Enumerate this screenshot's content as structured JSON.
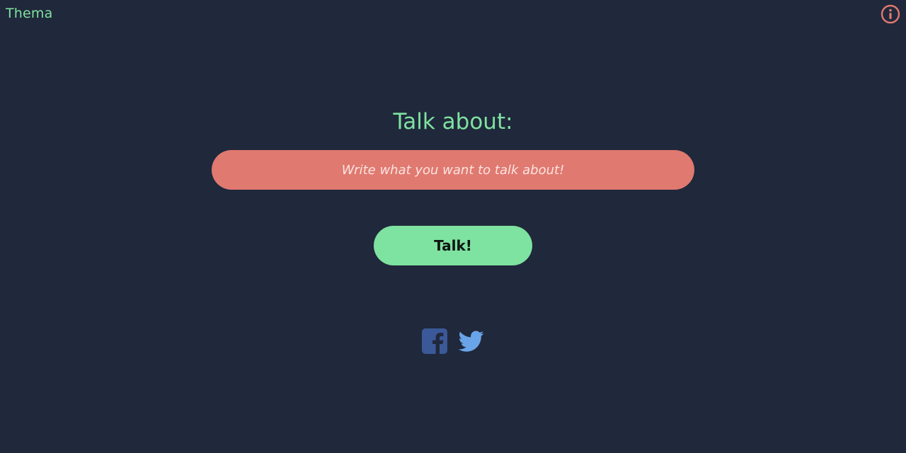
{
  "header": {
    "brand": "Thema",
    "info_icon": "info-circle-icon"
  },
  "main": {
    "heading": "Talk about:",
    "input": {
      "placeholder": "Write what you want to talk about!",
      "value": ""
    },
    "button_label": "Talk!"
  },
  "social": [
    {
      "icon": "facebook-icon",
      "color": "#3b5998"
    },
    {
      "icon": "twitter-icon",
      "color": "#55acee"
    }
  ],
  "colors": {
    "background": "#20283b",
    "accent_green": "#7ee2a0",
    "accent_coral": "#e07970"
  }
}
